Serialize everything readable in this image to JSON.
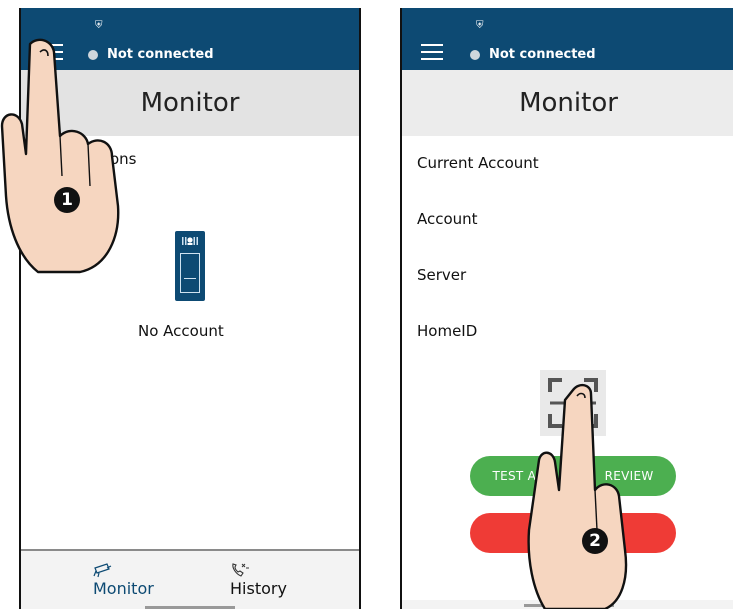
{
  "left": {
    "status": {
      "icon": "shield-icon",
      "connection": "Not connected"
    },
    "header_title": "Monitor",
    "options_label": "ons",
    "no_account": "No Account",
    "nav": [
      {
        "label": "Monitor",
        "icon": "camera-icon",
        "active": true
      },
      {
        "label": "History",
        "icon": "phone-history-icon",
        "active": false
      }
    ],
    "step": "1"
  },
  "right": {
    "status": {
      "icon": "shield-icon",
      "connection": "Not connected"
    },
    "header_title": "Monitor",
    "fields": [
      "Current Account",
      "Account",
      "Server",
      "HomeID"
    ],
    "test_button": "TEST AC",
    "test_button_tail": "REVIEW",
    "clear_button": "CLE",
    "step": "2"
  },
  "colors": {
    "brand": "#0d4a73",
    "test": "#4caf50",
    "clear": "#ef3b36"
  }
}
